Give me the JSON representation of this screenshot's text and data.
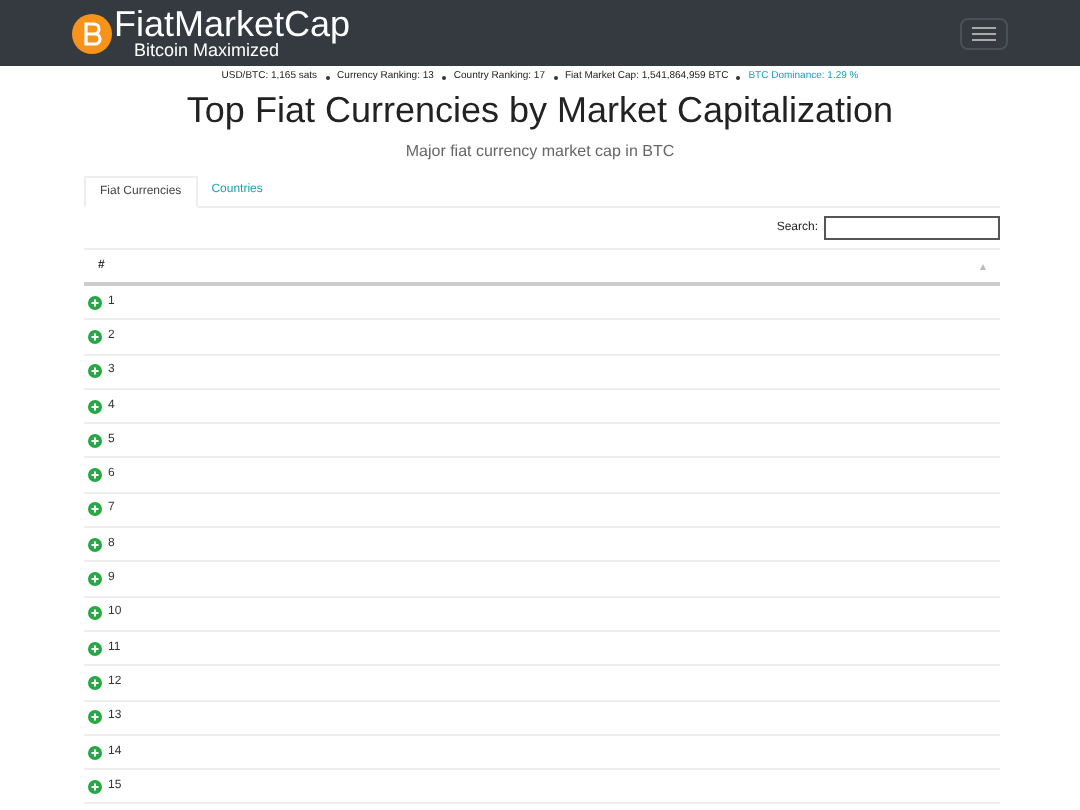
{
  "brand": {
    "name": "FiatMarketCap",
    "tagline": "Bitcoin Maximized"
  },
  "stats": [
    {
      "text": "USD/BTC: 1,165 sats",
      "kind": "plain"
    },
    {
      "text": "Currency Ranking: 13",
      "kind": "plain"
    },
    {
      "text": "Country Ranking: 17",
      "kind": "plain"
    },
    {
      "text": "Fiat Market Cap: 1,541,864,959 BTC",
      "kind": "plain"
    },
    {
      "text": "BTC Dominance: 1.29 %",
      "kind": "link"
    }
  ],
  "title": "Top Fiat Currencies by Market Capitalization",
  "subtitle": "Major fiat currency market cap in BTC",
  "tabs": [
    {
      "label": "Fiat Currencies",
      "selected": true
    },
    {
      "label": "Countries",
      "selected": false
    }
  ],
  "search": {
    "label": "Search:"
  },
  "table": {
    "columns": [
      "#"
    ],
    "rows": [
      "1",
      "2",
      "3",
      "4",
      "5",
      "6",
      "7",
      "8",
      "9",
      "10",
      "11",
      "12",
      "13",
      "14",
      "15"
    ]
  }
}
